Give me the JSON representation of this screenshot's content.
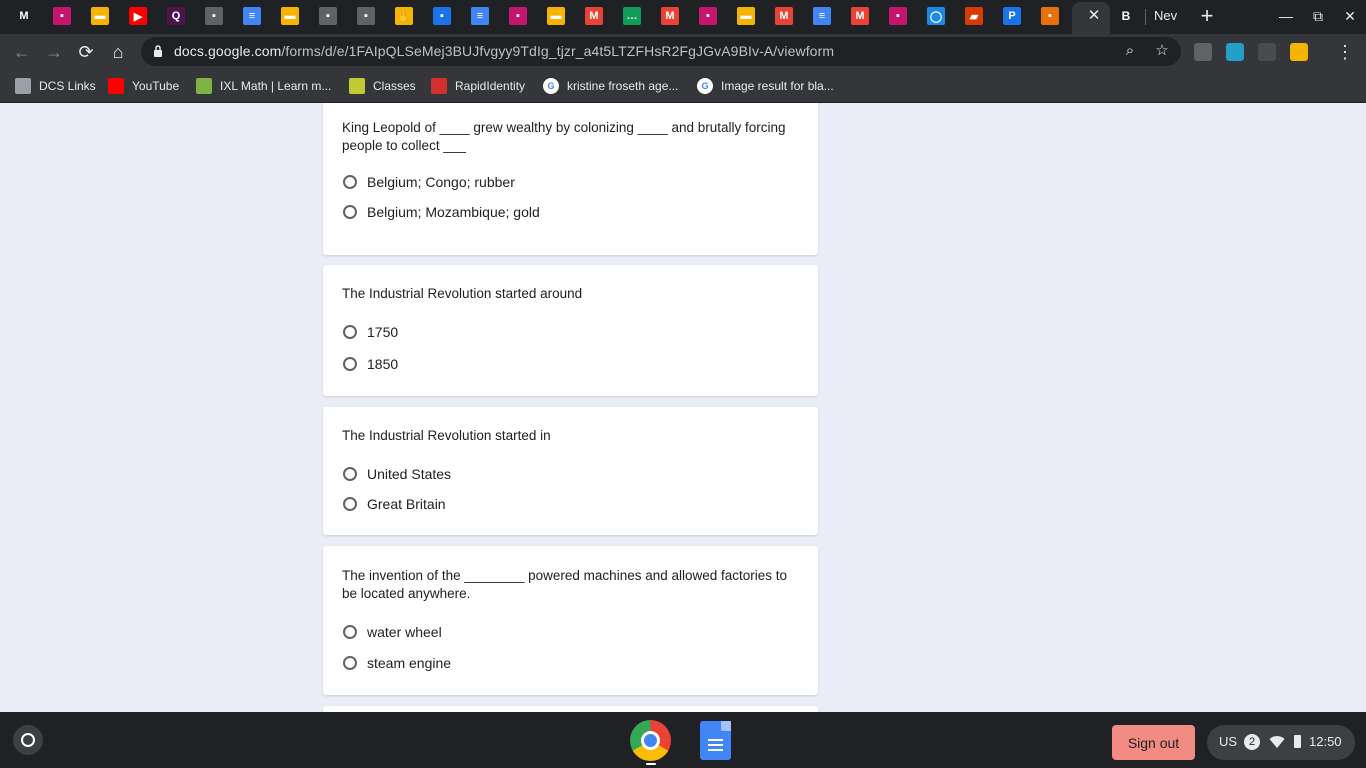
{
  "tabs": {
    "icons": [
      {
        "name": "gmail-m-icon",
        "color": "#202124",
        "glyph": "M"
      },
      {
        "name": "classroom-assignment-icon",
        "color": "#c5166f",
        "glyph": "▪"
      },
      {
        "name": "slides-icon",
        "color": "#f4b400",
        "glyph": "▬"
      },
      {
        "name": "youtube-icon",
        "color": "#ff0000",
        "glyph": "▶"
      },
      {
        "name": "quizlet-icon",
        "color": "#4a154b",
        "glyph": "Q"
      },
      {
        "name": "classroom-icon",
        "color": "#5f6368",
        "glyph": "▪"
      },
      {
        "name": "docs-icon",
        "color": "#4285f4",
        "glyph": "≡"
      },
      {
        "name": "slides-icon",
        "color": "#f4b400",
        "glyph": "▬"
      },
      {
        "name": "classroom-icon",
        "color": "#5f6368",
        "glyph": "▪"
      },
      {
        "name": "classroom-icon",
        "color": "#5f6368",
        "glyph": "▪"
      },
      {
        "name": "extension-icon",
        "color": "#f4b400",
        "glyph": "✋"
      },
      {
        "name": "contacts-icon",
        "color": "#1a73e8",
        "glyph": "▪"
      },
      {
        "name": "docs-icon",
        "color": "#4285f4",
        "glyph": "≡"
      },
      {
        "name": "classroom-assignment-icon",
        "color": "#c5166f",
        "glyph": "▪"
      },
      {
        "name": "slides-icon",
        "color": "#f4b400",
        "glyph": "▬"
      },
      {
        "name": "gmail-icon",
        "color": "#ea4335",
        "glyph": "M"
      },
      {
        "name": "hangouts-icon",
        "color": "#0f9d58",
        "glyph": "…"
      },
      {
        "name": "gmail-icon",
        "color": "#ea4335",
        "glyph": "M"
      },
      {
        "name": "classroom-assignment-icon",
        "color": "#c5166f",
        "glyph": "▪"
      },
      {
        "name": "slides-icon",
        "color": "#f4b400",
        "glyph": "▬"
      },
      {
        "name": "gmail-icon",
        "color": "#ea4335",
        "glyph": "M"
      },
      {
        "name": "docs-icon",
        "color": "#4285f4",
        "glyph": "≡"
      },
      {
        "name": "gmail-icon",
        "color": "#ea4335",
        "glyph": "M"
      },
      {
        "name": "classroom-assignment-icon",
        "color": "#c5166f",
        "glyph": "▪"
      },
      {
        "name": "circle-app-icon",
        "color": "#1e88e5",
        "glyph": "◯"
      },
      {
        "name": "office-icon",
        "color": "#d83b01",
        "glyph": "▰"
      },
      {
        "name": "pearson-icon",
        "color": "#1a73e8",
        "glyph": "P"
      },
      {
        "name": "app-icon",
        "color": "#e8710a",
        "glyph": "▪"
      }
    ],
    "active_close": "✕",
    "after_active_glyph": "B",
    "new_tab_label": "Nev"
  },
  "window": {
    "minimize": "—",
    "maximize": "⧉",
    "close": "✕"
  },
  "toolbar": {
    "url_host": "docs.google.com",
    "url_path": "/forms/d/e/1FAIpQLSeMej3BUJfvgyy9TdIg_tjzr_a4t5LTZFHsR2FgJGvA9BIv-A/viewform"
  },
  "bookmarks": [
    {
      "label": "DCS Links",
      "icon": "folder-icon",
      "color": "#9aa0a6"
    },
    {
      "label": "YouTube",
      "icon": "youtube-icon",
      "color": "#ff0000"
    },
    {
      "label": "IXL Math | Learn m...",
      "icon": "ixl-icon",
      "color": "#7cb342"
    },
    {
      "label": "Classes",
      "icon": "classes-icon",
      "color": "#c0ca33"
    },
    {
      "label": "RapidIdentity",
      "icon": "rapididentity-icon",
      "color": "#d32f2f"
    },
    {
      "label": "kristine froseth age...",
      "icon": "google-icon",
      "color": "#ffffff"
    },
    {
      "label": "Image result for bla...",
      "icon": "google-icon",
      "color": "#ffffff"
    }
  ],
  "questions": [
    {
      "text": "King Leopold of ____ grew wealthy by colonizing ____ and brutally forcing people to collect ___",
      "options": [
        "Belgium; Congo; rubber",
        "Belgium; Mozambique; gold"
      ]
    },
    {
      "text": "The Industrial Revolution started around",
      "options": [
        "1750",
        "1850"
      ]
    },
    {
      "text": "The Industrial Revolution started in",
      "options": [
        "United States",
        "Great Britain"
      ]
    },
    {
      "text": "The invention of the ________ powered machines and allowed factories to be located anywhere.",
      "options": [
        "water wheel",
        "steam engine"
      ]
    }
  ],
  "shelf": {
    "signout_label": "Sign out",
    "ime": "US",
    "notification_count": "2",
    "time": "12:50"
  }
}
